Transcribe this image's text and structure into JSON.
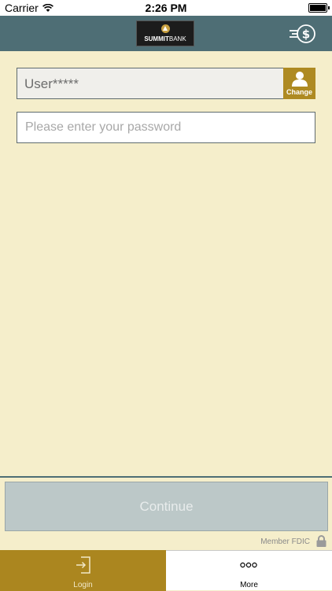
{
  "status_bar": {
    "carrier": "Carrier",
    "time": "2:26 PM"
  },
  "header": {
    "logo_bold": "SUMMIT",
    "logo_light": "BANK",
    "accent": "#4e6e75"
  },
  "login": {
    "user_value": "User*****",
    "change_label": "Change",
    "password_placeholder": "Please enter your password"
  },
  "actions": {
    "continue_label": "Continue"
  },
  "footer": {
    "fdic": "Member FDIC"
  },
  "tabs": [
    {
      "label": "Login",
      "icon": "login-icon",
      "active": true
    },
    {
      "label": "More",
      "icon": "more-dots-icon",
      "active": false
    }
  ],
  "colors": {
    "background": "#f5eecb",
    "gold": "#ab861f",
    "continue_disabled": "#bcc8c8"
  }
}
